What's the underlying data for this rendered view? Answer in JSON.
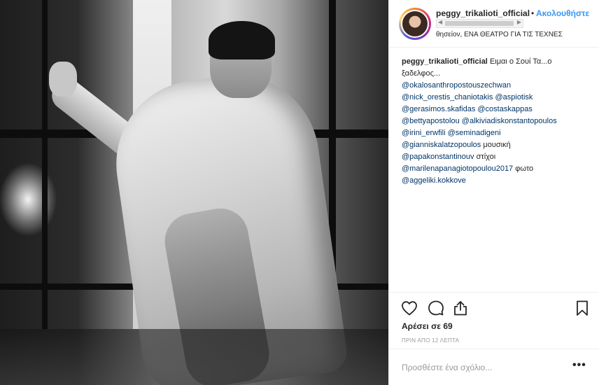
{
  "post": {
    "username": "peggy_trikalioti_official",
    "follow_label": "Ακολουθήστε",
    "dot": "•",
    "location": "θησείον, ΕΝΑ ΘΕΑΤΡΟ ΓΙΑ ΤΙΣ ΤΕΧΝΕΣ"
  },
  "caption": {
    "username": "peggy_trikalioti_official",
    "text": "Ειμαι ο Σουί Τα...ο ξαδελφος...",
    "lines": [
      {
        "mention": "@okalosanthropostouszechwan",
        "suffix": ""
      },
      {
        "mention": "@nick_orestis_chaniotakis",
        "mention2": "@aspiotisk",
        "suffix": ""
      },
      {
        "mention": "@gerasimos.skafidas",
        "mention2": "@costaskappas",
        "suffix": ""
      },
      {
        "mention": "@bettyapostolou",
        "mention2": "@alkiviadiskonstantopoulos",
        "suffix": ""
      },
      {
        "mention": "@irini_erwfili",
        "mention2": "@seminadigeni",
        "suffix": ""
      },
      {
        "mention": "@gianniskalatzopoulos",
        "suffix": "μουσική"
      },
      {
        "mention": "@papakonstantinouv",
        "suffix": "στίχοι"
      },
      {
        "mention": "@marilenapanagiotopoulou2017",
        "suffix": "φωτο"
      },
      {
        "mention": "@aggeliki.kokkove",
        "suffix": ""
      }
    ]
  },
  "actions": {
    "likes": "Αρέσει σε 69",
    "time": "ΠΡΙΝ ΑΠΟ 12 ΛΕΠΤΑ",
    "icons": [
      "heart-icon",
      "comment-icon",
      "share-icon",
      "bookmark-icon"
    ]
  },
  "comment": {
    "placeholder": "Προσθέστε ένα σχόλιο...",
    "more": "•••"
  },
  "colors": {
    "link": "#3897f0",
    "mention": "#003569",
    "muted": "#999999"
  }
}
